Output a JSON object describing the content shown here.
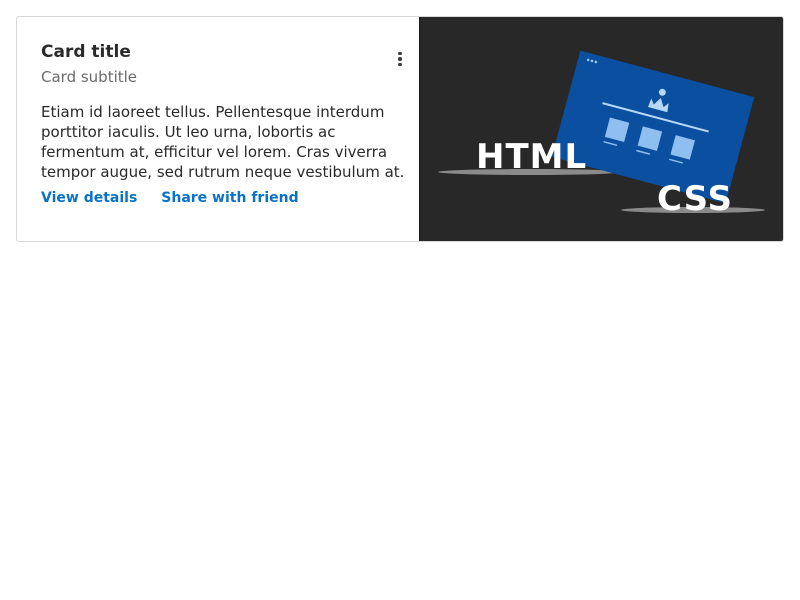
{
  "card": {
    "title": "Card title",
    "subtitle": "Card subtitle",
    "text": "Etiam id laoreet tellus. Pellentesque interdum porttitor iaculis. Ut leo urna, lobortis ac fermentum at, efficitur vel lorem. Cras viverra tempor augue, sed rutrum neque vestibulum at.",
    "actions": [
      {
        "label": "View details"
      },
      {
        "label": "Share with friend"
      }
    ],
    "menu_icon": "more-vertical-icon",
    "media": {
      "html_text": "HTML",
      "css_text": "CSS"
    }
  },
  "colors": {
    "link": "#0b72c9",
    "media_background": "#282828",
    "browser_blue": "#0a4fa0"
  }
}
